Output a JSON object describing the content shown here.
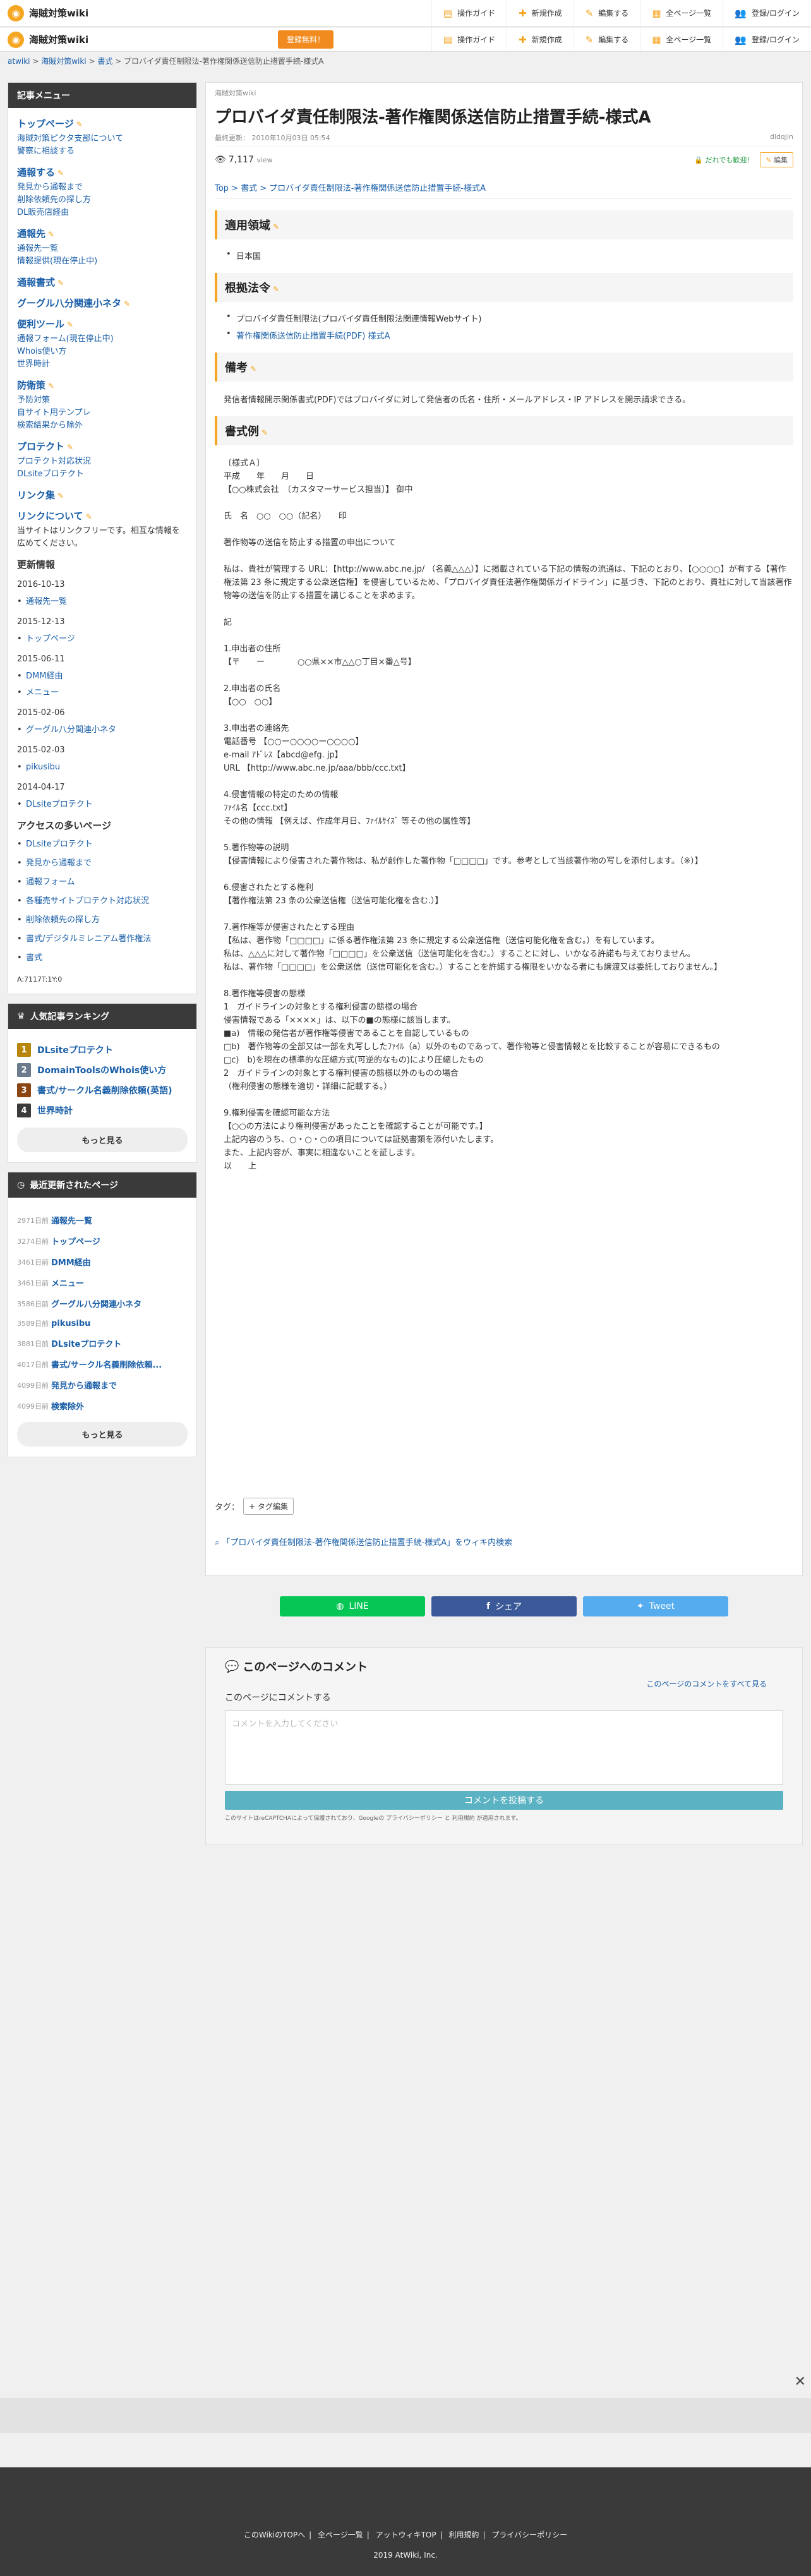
{
  "header": {
    "site_name": "海賊対策wiki",
    "signup": "登録無料！",
    "nav": [
      "操作ガイド",
      "新規作成",
      "編集する",
      "全ページ一覧",
      "登録/ログイン"
    ]
  },
  "breadcrumb": [
    "atwiki",
    "海賊対策wiki",
    "書式",
    "プロバイダ責任制限法-著作権関係送信防止措置手続-様式A"
  ],
  "sidebar": {
    "menu_title": "記事メニュー",
    "sections": [
      {
        "h": "トップページ",
        "links": [
          "海賊対策ピクタ支部について",
          "警察に相談する"
        ]
      },
      {
        "h": "通報する",
        "links": [
          "発見から通報まで",
          "削除依頼先の探し方",
          "DL販売店経由"
        ]
      },
      {
        "h": "通報先",
        "links": [
          "通報先一覧",
          "情報提供(現在停止中)"
        ]
      },
      {
        "h": "通報書式",
        "links": []
      },
      {
        "h": "グーグル八分関連小ネタ",
        "links": []
      },
      {
        "h": "便利ツール",
        "links": [
          "通報フォーム(現在停止中)",
          "Whois使い方",
          "世界時計"
        ]
      },
      {
        "h": "防衛策",
        "links": [
          "予防対策",
          "自サイト用テンプレ",
          "検索結果から除外"
        ]
      },
      {
        "h": "プロテクト",
        "links": [
          "プロテクト対応状況",
          "DLsiteプロテクト"
        ]
      },
      {
        "h": "リンク集",
        "links": []
      }
    ],
    "link_about_h": "リンクについて",
    "link_about_text": "当サイトはリンクフリーです。相互な情報を広めてください。",
    "updates_h": "更新情報",
    "updates": [
      {
        "date": "2016-10-13",
        "items": [
          "通報先一覧"
        ]
      },
      {
        "date": "2015-12-13",
        "items": [
          "トップページ"
        ]
      },
      {
        "date": "2015-06-11",
        "items": [
          "DMM経由",
          "メニュー"
        ]
      },
      {
        "date": "2015-02-06",
        "items": [
          "グーグル八分関連小ネタ"
        ]
      },
      {
        "date": "2015-02-03",
        "items": [
          "pikusibu"
        ]
      },
      {
        "date": "2014-04-17",
        "items": [
          "DLsiteプロテクト"
        ]
      }
    ],
    "popular_h": "アクセスの多いページ",
    "popular": [
      "DLsiteプロテクト",
      "発見から通報まで",
      "通報フォーム",
      "各種売サイトプロテクト対応状況",
      "削除依頼先の探し方",
      "書式/デジタルミレニアム著作権法",
      "書式"
    ],
    "counter": "A:7117T:1Y:0",
    "ranking_title": "人気記事ランキング",
    "ranking": [
      {
        "n": "1",
        "t": "DLsiteプロテクト",
        "c": "#b8860b"
      },
      {
        "n": "2",
        "t": "DomainToolsのWhois使い方",
        "c": "#6b7b8c"
      },
      {
        "n": "3",
        "t": "書式/サークル名義削除依頼(英語)",
        "c": "#8b4513"
      },
      {
        "n": "4",
        "t": "世界時計",
        "c": "#3a3a3a"
      }
    ],
    "more": "もっと見る",
    "recent_title": "最近更新されたページ",
    "recent": [
      {
        "ago": "2971日前",
        "t": "通報先一覧"
      },
      {
        "ago": "3274日前",
        "t": "トップページ"
      },
      {
        "ago": "3461日前",
        "t": "DMM経由"
      },
      {
        "ago": "3461日前",
        "t": "メニュー"
      },
      {
        "ago": "3586日前",
        "t": "グーグル八分関連小ネタ"
      },
      {
        "ago": "3589日前",
        "t": "pikusibu"
      },
      {
        "ago": "3881日前",
        "t": "DLsiteプロテクト"
      },
      {
        "ago": "4017日前",
        "t": "書式/サークル名義削除依頼..."
      },
      {
        "ago": "4099日前",
        "t": "発見から通報まで"
      },
      {
        "ago": "4099日前",
        "t": "検索除外"
      }
    ]
  },
  "main": {
    "category": "海賊対策wiki",
    "title": "プロバイダ責任制限法-著作権関係送信防止措置手続-様式A",
    "updated": "最終更新： 2010年10月03日 05:54",
    "user": "dldqjin",
    "views": "7,117",
    "views_unit": "view",
    "edit_lock": "だれでも歓迎！",
    "edit": "編集",
    "path": "Top > 書式 > プロバイダ責任制限法-著作権関係送信防止措置手続-様式A",
    "h_area": "適用領域",
    "area_item": "日本国",
    "h_law": "根拠法令",
    "law_items": [
      "プロバイダ責任制限法(プロバイダ責任制限法関連情報Webサイト)",
      "著作権関係送信防止措置手続(PDF) 様式A"
    ],
    "h_note": "備考",
    "note": "発信者情報開示関係書式(PDF)ではプロバイダに対して発信者の氏名・住所・メールアドレス・IP アドレスを開示請求できる。",
    "h_example": "書式例",
    "form_text": "〔様式Ａ〕\n平成　　年　　月　　日\n【○○株式会社　〔カスタマーサービス担当〕】 御中\n\n氏　名　○○　○○（記名）　　印\n\n著作物等の送信を防止する措置の申出について\n\n私は、貴社が管理する URL：【http://www.abc.ne.jp/ （名義△△△）】に掲載されている下記の情報の流通は、下記のとおり、【○○○○】が有する【著作権法第 23 条に規定する公衆送信権】を侵害しているため、「プロバイダ責任法著作権関係ガイドライン」に基づき、下記のとおり、貴社に対して当該著作物等の送信を防止する措置を講じることを求めます。\n\n記\n\n1.申出者の住所\n【〒　　ー　　　　○○県××市△△○丁目×番△号】\n\n2.申出者の氏名\n【○○　○○】\n\n3.申出者の連絡先\n電話番号 【○○ー○○○○ー○○○○】\ne-mail ｱﾄﾞﾚｽ【abcd@efg. jp】\nURL 【http://www.abc.ne.jp/aaa/bbb/ccc.txt】\n\n4.侵害情報の特定のための情報\nﾌｧｲﾙ名【ccc.txt】\nその他の情報 【例えば、作成年月日、ﾌｧｲﾙｻｲｽﾞ 等その他の属性等】\n\n5.著作物等の説明\n【侵害情報により侵害された著作物は、私が創作した著作物「□□□□」です。参考として当該著作物の写しを添付します。（※）】\n\n6.侵害されたとする権利\n【著作権法第 23 条の公衆送信権（送信可能化権を含む.）】\n\n7.著作権等が侵害されたとする理由\n【私は、著作物「□□□□」に係る著作権法第 23 条に規定する公衆送信権（送信可能化権を含む。）を有しています。\n私は、△△△に対して著作物「□□□□」を公衆送信（送信可能化を含む。）することに対し、いかなる許諾も与えておりません。\n私は、著作物「□□□□」を公衆送信（送信可能化を含む。）することを許諾する権限をいかなる者にも譲渡又は委託しておりません。】\n\n8.著作権等侵害の態様\n1　ガイドラインの対象とする権利侵害の態様の場合\n侵害情報である「××××」は、以下の■の態様に該当します。\n■a)　情報の発信者が著作権等侵害であることを自認しているもの\n□b)　著作物等の全部又は一部を丸写ししたﾌｧｲﾙ（a）以外のものであって、著作物等と侵害情報とを比較することが容易にできるもの\n□c)　b)を現在の標準的な圧縮方式(可逆的なもの)により圧縮したもの\n2　ガイドラインの対象とする権利侵害の態様以外のものの場合\n（権利侵害の態様を適切・詳細に記載する。）\n\n9.権利侵害を確認可能な方法\n【○○の方法により権利侵害があったことを確認することが可能です。】\n上記内容のうち、○・○・○の項目については証拠書類を添付いたします。\nまた、上記内容が、事実に相違ないことを証します。\n以　　上",
    "tag_label": "タグ：",
    "tag_edit": "+ タグ編集",
    "search_text": "「プロバイダ責任制限法-著作権関係送信防止措置手続-様式A」をウィキ内検索"
  },
  "share": {
    "line": "LINE",
    "facebook": "シェア",
    "twitter": "Tweet"
  },
  "comments": {
    "title": "このページへのコメント",
    "all": "このページのコメントをすべて見る",
    "sub": "このページにコメントする",
    "placeholder": "コメントを入力してください",
    "post": "コメントを投稿する",
    "note": "このサイトはreCAPTCHAによって保護されており、Googleの プライバシーポリシー と 利用規約 が適用されます。"
  },
  "footer": {
    "links": [
      "このWikiのTOPへ",
      "全ページ一覧",
      "アットウィキTOP",
      "利用規約",
      "プライバシーポリシー"
    ],
    "copy": "2019 AtWiki, Inc."
  }
}
